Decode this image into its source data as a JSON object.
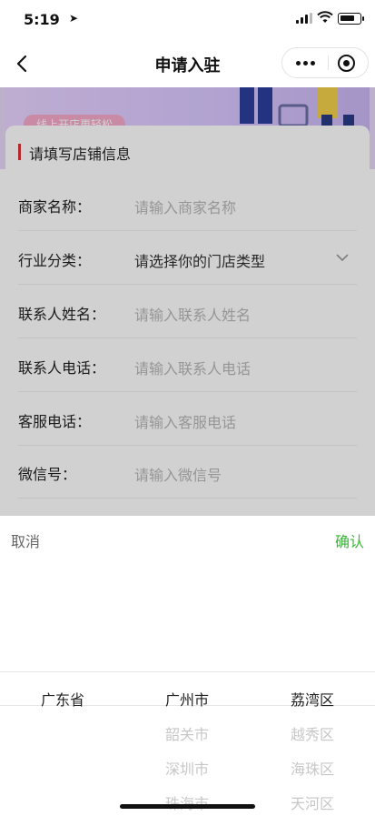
{
  "status_bar": {
    "time": "5:19",
    "battery_level": 0.8
  },
  "nav": {
    "title": "申请入驻"
  },
  "banner": {
    "headline": "",
    "sub": "线上开店更轻松"
  },
  "form": {
    "section_title": "请填写店铺信息",
    "rows": [
      {
        "label": "商家名称：",
        "placeholder": "请输入商家名称"
      },
      {
        "label": "行业分类：",
        "placeholder": "请选择你的门店类型"
      },
      {
        "label": "联系人姓名：",
        "placeholder": "请输入联系人姓名"
      },
      {
        "label": "联系人电话：",
        "placeholder": "请输入联系人电话"
      },
      {
        "label": "客服电话：",
        "placeholder": "请输入客服电话"
      },
      {
        "label": "微信号：",
        "placeholder": "请输入微信号"
      }
    ]
  },
  "picker": {
    "cancel": "取消",
    "confirm": "确认",
    "provinces": [
      "广东省"
    ],
    "cities": [
      "广州市",
      "韶关市",
      "深圳市",
      "珠海市"
    ],
    "districts": [
      "荔湾区",
      "越秀区",
      "海珠区",
      "天河区"
    ]
  },
  "colors": {
    "accent_red": "#d9333a",
    "confirm_green": "#3cb53a",
    "banner_purple": "#d8c6ff"
  },
  "icons": {
    "back": "chevron-left-icon",
    "more": "more-dots-icon",
    "close": "mini-program-close-icon",
    "dropdown": "chevron-down-icon"
  }
}
